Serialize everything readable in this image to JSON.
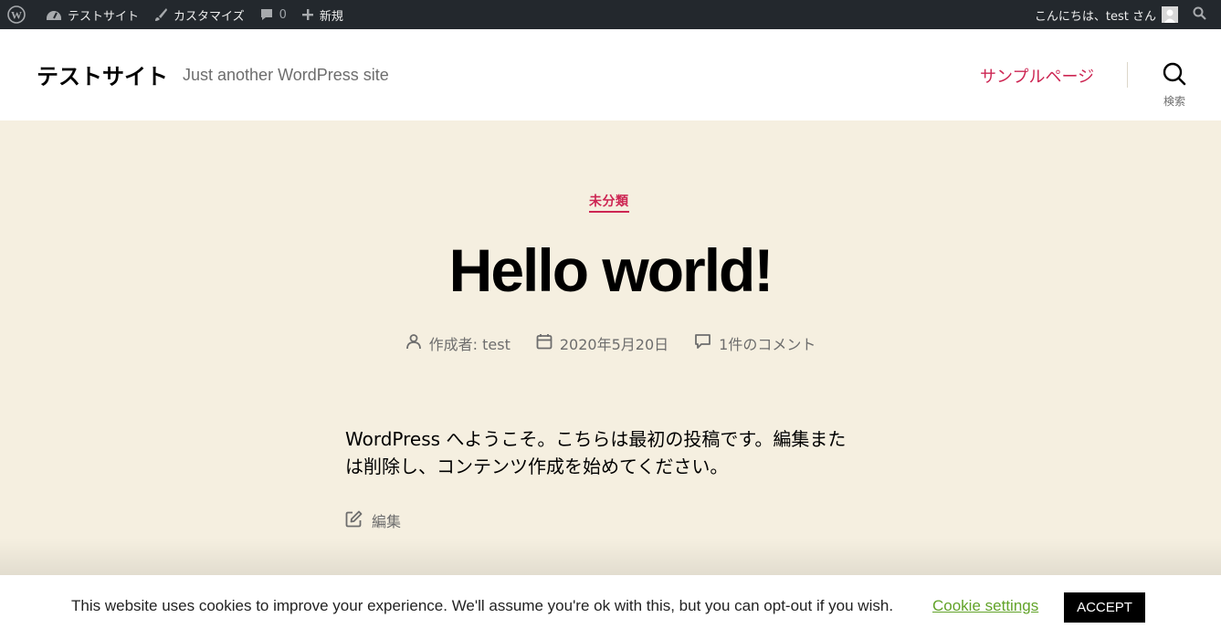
{
  "adminbar": {
    "site_name": "テストサイト",
    "customize": "カスタマイズ",
    "comments_count": "0",
    "new_label": "新規",
    "greeting": "こんにちは、test さん"
  },
  "header": {
    "site_title": "テストサイト",
    "tagline": "Just another WordPress site",
    "nav_item": "サンプルページ",
    "search_label": "検索"
  },
  "post": {
    "category": "未分類",
    "title": "Hello world!",
    "author": "作成者: test",
    "date": "2020年5月20日",
    "comments": "1件のコメント",
    "excerpt_line1": "WordPress へようこそ。こちらは最初の投稿です。編集また",
    "excerpt_line2": "は削除し、コンテンツ作成を始めてください。",
    "edit_label": "編集"
  },
  "cookie": {
    "message": "This website uses cookies to improve your experience. We'll assume you're ok with this, but you can opt-out if you wish.",
    "settings_label": "Cookie settings",
    "accept_label": "ACCEPT"
  },
  "colors": {
    "accent": "#cd2653",
    "background": "#f5efe0",
    "adminbar": "#23282d",
    "cookie_link": "#62a329"
  }
}
